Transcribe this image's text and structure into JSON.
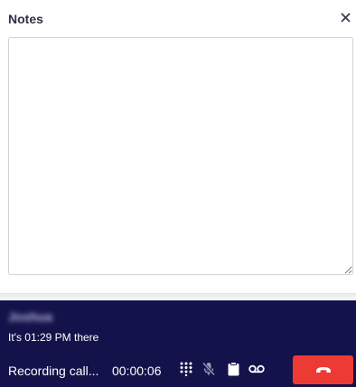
{
  "notes": {
    "title": "Notes",
    "close_icon": "close-icon",
    "textarea_value": ""
  },
  "call": {
    "caller_name": "Joshua",
    "local_time": "It's 01:29 PM there",
    "status": "Recording call...",
    "timer": "00:00:06",
    "controls": {
      "keypad_icon": "dialpad-icon",
      "mute_icon": "mic-off-icon",
      "notes_icon": "clipboard-icon",
      "voicemail_icon": "voicemail-icon",
      "hangup_icon": "phone-hangup-icon"
    },
    "colors": {
      "bar_background": "#14124a",
      "hangup": "#ee3a35"
    }
  }
}
